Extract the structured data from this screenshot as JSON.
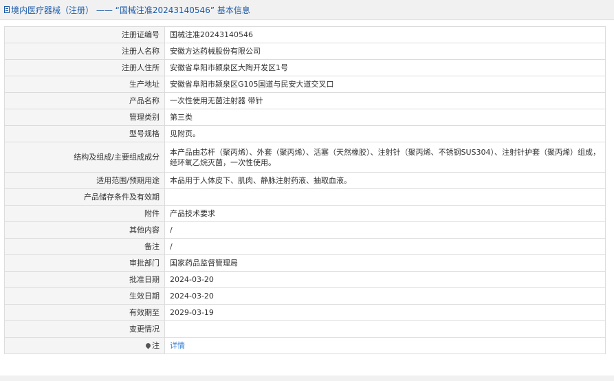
{
  "header": {
    "title": "境内医疗器械（注册） —— “国械注准20243140546” 基本信息"
  },
  "rows": [
    {
      "label": "注册证编号",
      "value": "国械注准20243140546"
    },
    {
      "label": "注册人名称",
      "value": "安徽方达药械股份有限公司"
    },
    {
      "label": "注册人住所",
      "value": "安徽省阜阳市颍泉区大陶开发区1号"
    },
    {
      "label": "生产地址",
      "value": "安徽省阜阳市颍泉区G105国道与民安大道交叉口"
    },
    {
      "label": "产品名称",
      "value": "一次性使用无菌注射器 带针"
    },
    {
      "label": "管理类别",
      "value": "第三类"
    },
    {
      "label": "型号规格",
      "value": "见附页。"
    },
    {
      "label": "结构及组成/主要组成成分",
      "value": "本产品由芯杆（聚丙烯）、外套（聚丙烯）、活塞（天然橡胶）、注射针（聚丙烯、不锈钢SUS304）、注射针护套（聚丙烯）组成，经环氧乙烷灭菌，一次性使用。"
    },
    {
      "label": "适用范围/预期用途",
      "value": "本品用于人体皮下、肌肉、静脉注射药液、抽取血液。"
    },
    {
      "label": "产品储存条件及有效期",
      "value": ""
    },
    {
      "label": "附件",
      "value": "产品技术要求"
    },
    {
      "label": "其他内容",
      "value": "/"
    },
    {
      "label": "备注",
      "value": "/"
    },
    {
      "label": "审批部门",
      "value": "国家药品监督管理局"
    },
    {
      "label": "批准日期",
      "value": "2024-03-20"
    },
    {
      "label": "生效日期",
      "value": "2024-03-20"
    },
    {
      "label": "有效期至",
      "value": "2029-03-19"
    },
    {
      "label": "变更情况",
      "value": ""
    }
  ],
  "note": {
    "label": "注",
    "link_text": "详情",
    "icon": "pin-icon"
  },
  "colors": {
    "title": "#1a5aa8",
    "link": "#3a82d6",
    "label_bg": "#f5f5f5",
    "border": "#dcdcdc"
  }
}
